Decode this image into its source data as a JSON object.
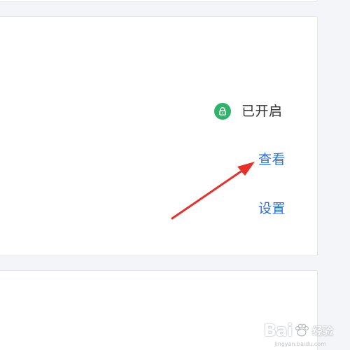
{
  "status": {
    "label": "已开启",
    "icon": "lock-icon",
    "color": "#2fb36a"
  },
  "links": {
    "view": "查看",
    "settings": "设置"
  },
  "annotation": {
    "arrow_color": "#e8302a"
  },
  "watermark": {
    "brand_prefix": "Bai",
    "brand_suffix": "经验",
    "url": "jingyan.baidu.com"
  }
}
